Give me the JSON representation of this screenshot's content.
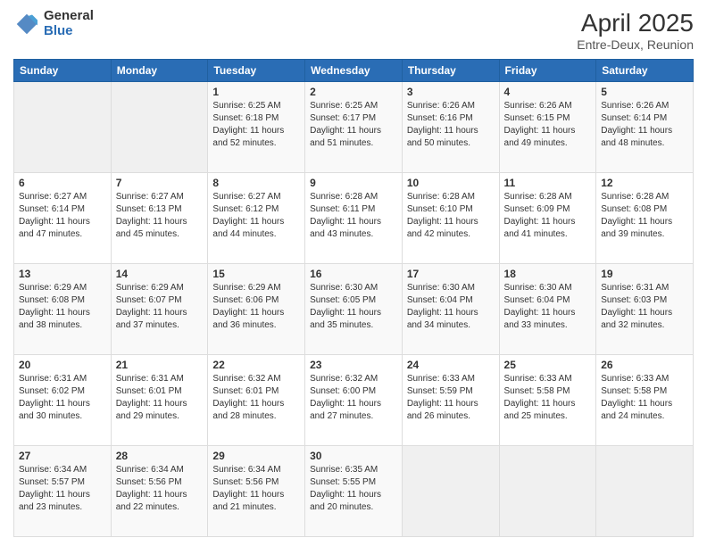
{
  "logo": {
    "general": "General",
    "blue": "Blue"
  },
  "title": "April 2025",
  "subtitle": "Entre-Deux, Reunion",
  "days_of_week": [
    "Sunday",
    "Monday",
    "Tuesday",
    "Wednesday",
    "Thursday",
    "Friday",
    "Saturday"
  ],
  "weeks": [
    [
      {
        "day": "",
        "sunrise": "",
        "sunset": "",
        "daylight": ""
      },
      {
        "day": "",
        "sunrise": "",
        "sunset": "",
        "daylight": ""
      },
      {
        "day": "1",
        "sunrise": "Sunrise: 6:25 AM",
        "sunset": "Sunset: 6:18 PM",
        "daylight": "Daylight: 11 hours and 52 minutes."
      },
      {
        "day": "2",
        "sunrise": "Sunrise: 6:25 AM",
        "sunset": "Sunset: 6:17 PM",
        "daylight": "Daylight: 11 hours and 51 minutes."
      },
      {
        "day": "3",
        "sunrise": "Sunrise: 6:26 AM",
        "sunset": "Sunset: 6:16 PM",
        "daylight": "Daylight: 11 hours and 50 minutes."
      },
      {
        "day": "4",
        "sunrise": "Sunrise: 6:26 AM",
        "sunset": "Sunset: 6:15 PM",
        "daylight": "Daylight: 11 hours and 49 minutes."
      },
      {
        "day": "5",
        "sunrise": "Sunrise: 6:26 AM",
        "sunset": "Sunset: 6:14 PM",
        "daylight": "Daylight: 11 hours and 48 minutes."
      }
    ],
    [
      {
        "day": "6",
        "sunrise": "Sunrise: 6:27 AM",
        "sunset": "Sunset: 6:14 PM",
        "daylight": "Daylight: 11 hours and 47 minutes."
      },
      {
        "day": "7",
        "sunrise": "Sunrise: 6:27 AM",
        "sunset": "Sunset: 6:13 PM",
        "daylight": "Daylight: 11 hours and 45 minutes."
      },
      {
        "day": "8",
        "sunrise": "Sunrise: 6:27 AM",
        "sunset": "Sunset: 6:12 PM",
        "daylight": "Daylight: 11 hours and 44 minutes."
      },
      {
        "day": "9",
        "sunrise": "Sunrise: 6:28 AM",
        "sunset": "Sunset: 6:11 PM",
        "daylight": "Daylight: 11 hours and 43 minutes."
      },
      {
        "day": "10",
        "sunrise": "Sunrise: 6:28 AM",
        "sunset": "Sunset: 6:10 PM",
        "daylight": "Daylight: 11 hours and 42 minutes."
      },
      {
        "day": "11",
        "sunrise": "Sunrise: 6:28 AM",
        "sunset": "Sunset: 6:09 PM",
        "daylight": "Daylight: 11 hours and 41 minutes."
      },
      {
        "day": "12",
        "sunrise": "Sunrise: 6:28 AM",
        "sunset": "Sunset: 6:08 PM",
        "daylight": "Daylight: 11 hours and 39 minutes."
      }
    ],
    [
      {
        "day": "13",
        "sunrise": "Sunrise: 6:29 AM",
        "sunset": "Sunset: 6:08 PM",
        "daylight": "Daylight: 11 hours and 38 minutes."
      },
      {
        "day": "14",
        "sunrise": "Sunrise: 6:29 AM",
        "sunset": "Sunset: 6:07 PM",
        "daylight": "Daylight: 11 hours and 37 minutes."
      },
      {
        "day": "15",
        "sunrise": "Sunrise: 6:29 AM",
        "sunset": "Sunset: 6:06 PM",
        "daylight": "Daylight: 11 hours and 36 minutes."
      },
      {
        "day": "16",
        "sunrise": "Sunrise: 6:30 AM",
        "sunset": "Sunset: 6:05 PM",
        "daylight": "Daylight: 11 hours and 35 minutes."
      },
      {
        "day": "17",
        "sunrise": "Sunrise: 6:30 AM",
        "sunset": "Sunset: 6:04 PM",
        "daylight": "Daylight: 11 hours and 34 minutes."
      },
      {
        "day": "18",
        "sunrise": "Sunrise: 6:30 AM",
        "sunset": "Sunset: 6:04 PM",
        "daylight": "Daylight: 11 hours and 33 minutes."
      },
      {
        "day": "19",
        "sunrise": "Sunrise: 6:31 AM",
        "sunset": "Sunset: 6:03 PM",
        "daylight": "Daylight: 11 hours and 32 minutes."
      }
    ],
    [
      {
        "day": "20",
        "sunrise": "Sunrise: 6:31 AM",
        "sunset": "Sunset: 6:02 PM",
        "daylight": "Daylight: 11 hours and 30 minutes."
      },
      {
        "day": "21",
        "sunrise": "Sunrise: 6:31 AM",
        "sunset": "Sunset: 6:01 PM",
        "daylight": "Daylight: 11 hours and 29 minutes."
      },
      {
        "day": "22",
        "sunrise": "Sunrise: 6:32 AM",
        "sunset": "Sunset: 6:01 PM",
        "daylight": "Daylight: 11 hours and 28 minutes."
      },
      {
        "day": "23",
        "sunrise": "Sunrise: 6:32 AM",
        "sunset": "Sunset: 6:00 PM",
        "daylight": "Daylight: 11 hours and 27 minutes."
      },
      {
        "day": "24",
        "sunrise": "Sunrise: 6:33 AM",
        "sunset": "Sunset: 5:59 PM",
        "daylight": "Daylight: 11 hours and 26 minutes."
      },
      {
        "day": "25",
        "sunrise": "Sunrise: 6:33 AM",
        "sunset": "Sunset: 5:58 PM",
        "daylight": "Daylight: 11 hours and 25 minutes."
      },
      {
        "day": "26",
        "sunrise": "Sunrise: 6:33 AM",
        "sunset": "Sunset: 5:58 PM",
        "daylight": "Daylight: 11 hours and 24 minutes."
      }
    ],
    [
      {
        "day": "27",
        "sunrise": "Sunrise: 6:34 AM",
        "sunset": "Sunset: 5:57 PM",
        "daylight": "Daylight: 11 hours and 23 minutes."
      },
      {
        "day": "28",
        "sunrise": "Sunrise: 6:34 AM",
        "sunset": "Sunset: 5:56 PM",
        "daylight": "Daylight: 11 hours and 22 minutes."
      },
      {
        "day": "29",
        "sunrise": "Sunrise: 6:34 AM",
        "sunset": "Sunset: 5:56 PM",
        "daylight": "Daylight: 11 hours and 21 minutes."
      },
      {
        "day": "30",
        "sunrise": "Sunrise: 6:35 AM",
        "sunset": "Sunset: 5:55 PM",
        "daylight": "Daylight: 11 hours and 20 minutes."
      },
      {
        "day": "",
        "sunrise": "",
        "sunset": "",
        "daylight": ""
      },
      {
        "day": "",
        "sunrise": "",
        "sunset": "",
        "daylight": ""
      },
      {
        "day": "",
        "sunrise": "",
        "sunset": "",
        "daylight": ""
      }
    ]
  ]
}
